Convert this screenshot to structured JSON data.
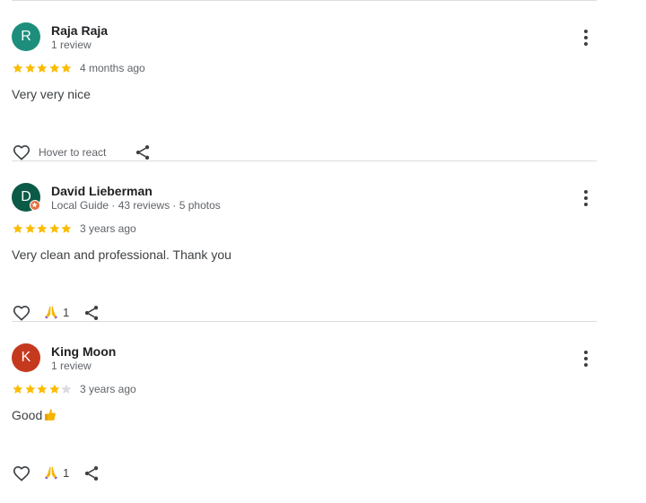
{
  "reviews": [
    {
      "initial": "R",
      "avatar_color": "#1e8e7c",
      "name": "Raja Raja",
      "meta": "1 review",
      "stars": 5,
      "date": "4 months ago",
      "text": "Very very nice",
      "hover_label": "Hover to react"
    },
    {
      "initial": "D",
      "avatar_color": "#0b5a47",
      "local_guide_badge": true,
      "name": "David Lieberman",
      "meta": "Local Guide · 43 reviews · 5 photos",
      "stars": 5,
      "date": "3 years ago",
      "text": "Very clean and professional. Thank you",
      "reaction_icon": "praying-hands-icon",
      "reaction_count": "1"
    },
    {
      "initial": "K",
      "avatar_color": "#c5391e",
      "name": "King Moon",
      "meta": "1 review",
      "stars": 4,
      "date": "3 years ago",
      "text": "Good",
      "text_icon": "thumbs-up-emoji-icon",
      "reaction_icon": "praying-hands-icon",
      "reaction_count": "1"
    }
  ],
  "colors": {
    "star_filled": "#fbbc04",
    "star_empty": "#dadce0",
    "divider": "#dadce0"
  }
}
